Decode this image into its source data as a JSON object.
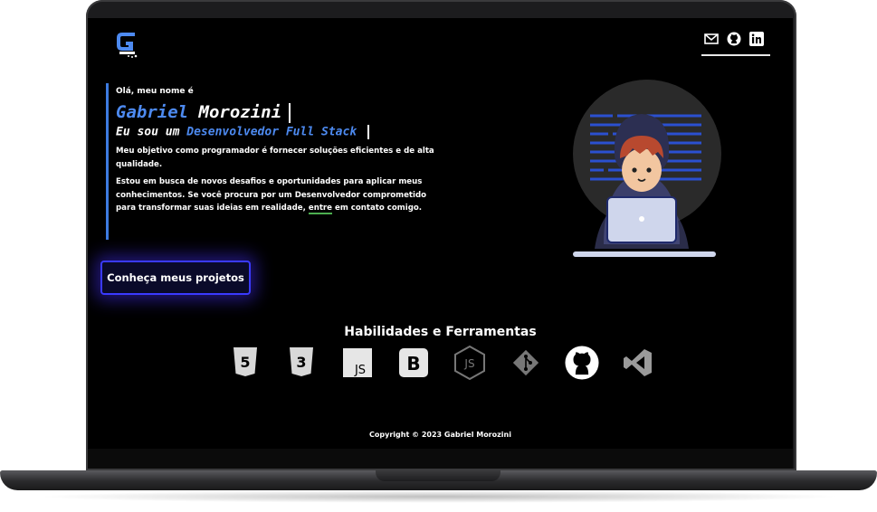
{
  "header": {
    "logo_icon": "g-logo-icon",
    "social": [
      {
        "name": "email-icon"
      },
      {
        "name": "github-icon"
      },
      {
        "name": "linkedin-icon"
      }
    ]
  },
  "intro": {
    "greeting": "Olá, meu nome é",
    "first_name": "Gabriel",
    "last_name": "Morozini",
    "role_prefix": "Eu sou um",
    "role": "Desenvolvedor Full Stack",
    "paragraph1": "Meu objetivo como programador é fornecer soluções eficientes e de alta qualidade.",
    "paragraph2_start": "Estou em busca de novos desafios e oportunidades para aplicar meus conhecimentos. Se você procura por um Desenvolvedor comprometido para transformar suas ideias em realidade,",
    "paragraph2_link": "entre",
    "paragraph2_end": "em contato comigo."
  },
  "cta": {
    "label": "Conheça meus projetos"
  },
  "skills": {
    "title": "Habilidades e Ferramentas",
    "icons": [
      "html5-icon",
      "css3-icon",
      "javascript-icon",
      "bootstrap-icon",
      "nodejs-icon",
      "git-icon",
      "github-icon",
      "vscode-icon"
    ],
    "js_text": "JS",
    "bootstrap_text": "B",
    "html_text": "5",
    "css_text": "3"
  },
  "footer": {
    "copyright": "Copyright © 2023 Gabriel Morozini"
  },
  "colors": {
    "accent_blue": "#4d8af0",
    "button_border": "#3a3aff",
    "background": "#000000"
  }
}
